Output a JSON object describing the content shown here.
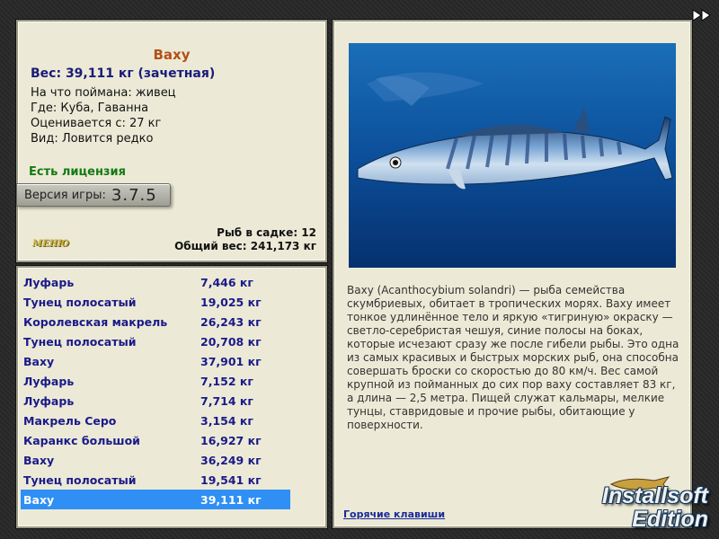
{
  "info": {
    "fish_name": "Ваху",
    "weight_line": "Вес: 39,111 кг (зачетная)",
    "caught_on": "На что поймана: живец",
    "where": "Где: Куба, Гаванна",
    "valued_from": "Оценивается с: 27 кг",
    "kind": "Вид: Ловится редко",
    "license": "Есть лицензия",
    "version_label": "Версия игры:",
    "version_number": "3.7.5",
    "menu_logo": "МЕНЮ",
    "fish_in_keepnet": "Рыб в садке: 12",
    "total_weight": "Общий вес: 241,173 кг"
  },
  "catch_list": [
    {
      "name": "Луфарь",
      "weight": "7,446 кг"
    },
    {
      "name": "Тунец полосатый",
      "weight": "19,025 кг"
    },
    {
      "name": "Королевская макрель",
      "weight": "26,243 кг"
    },
    {
      "name": "Тунец полосатый",
      "weight": "20,708 кг"
    },
    {
      "name": "Ваху",
      "weight": "37,901 кг"
    },
    {
      "name": "Луфарь",
      "weight": "7,152 кг"
    },
    {
      "name": "Луфарь",
      "weight": "7,714 кг"
    },
    {
      "name": "Макрель Серо",
      "weight": "3,154 кг"
    },
    {
      "name": "Каранкс большой",
      "weight": "16,927 кг"
    },
    {
      "name": "Ваху",
      "weight": "36,249 кг"
    },
    {
      "name": "Тунец полосатый",
      "weight": "19,541 кг"
    },
    {
      "name": "Ваху",
      "weight": "39,111 кг",
      "selected": true
    }
  ],
  "description": "Ваху (Acanthocybium solandri) — рыба семейства скумбриевых, обитает в тропических морях. Ваху имеет тонкое удлинённое тело и яркую «тигриную» окраску — светло-серебристая чешуя, синие полосы на боках, которые исчезают сразу же после гибели рыбы. Это одна из самых красивых и быстрых морских рыб, она способна совершать броски со скоростью до 80 км/ч. Вес самой крупной из пойманных до сих пор ваху составляет 83 кг, а длина — 2,5 метра. Пищей служат кальмары, мелкие тунцы, ставридовые и прочие рыбы, обитающие у поверхности.",
  "hotkeys_link": "Горячие клавиши",
  "watermark": {
    "line1": "Installsoft",
    "line2": "Edition"
  },
  "icons": {
    "next": "double-arrow-right-icon",
    "fish_photo": "wahoo-fish-photo"
  },
  "colors": {
    "selected_row": "#2f8ff5",
    "fish_name": "#b4501a",
    "list_text": "#1a1a8a",
    "license": "#137a13"
  }
}
